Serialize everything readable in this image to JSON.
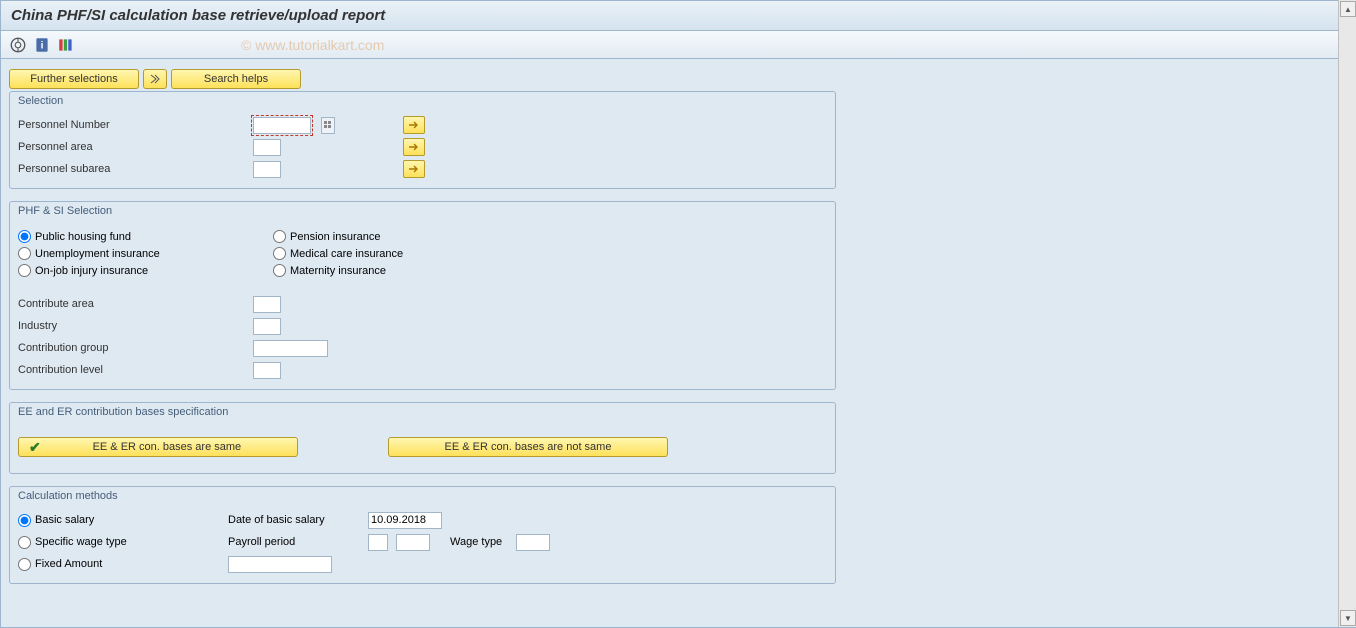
{
  "title": "China PHF/SI calculation base retrieve/upload report",
  "watermark": "© www.tutorialkart.com",
  "topButtons": {
    "further": "Further selections",
    "searchHelps": "Search helps"
  },
  "groups": {
    "selection": {
      "title": "Selection",
      "personnelNumber": "Personnel Number",
      "personnelArea": "Personnel area",
      "personnelSubarea": "Personnel subarea"
    },
    "phfsi": {
      "title": "PHF & SI Selection",
      "options": {
        "phf": "Public housing fund",
        "pension": "Pension insurance",
        "unemployment": "Unemployment insurance",
        "medical": "Medical care insurance",
        "injury": "On-job injury insurance",
        "maternity": "Maternity insurance"
      },
      "contributeArea": "Contribute area",
      "industry": "Industry",
      "contributionGroup": "Contribution group",
      "contributionLevel": "Contribution level"
    },
    "eeer": {
      "title": "EE and ER contribution bases specification",
      "sameBtn": "EE & ER con. bases are same",
      "notSameBtn": "EE & ER con. bases are not same"
    },
    "calc": {
      "title": "Calculation methods",
      "basic": "Basic salary",
      "specific": "Specific wage type",
      "fixed": "Fixed Amount",
      "dateOfBasic": "Date of basic salary",
      "dateValue": "10.09.2018",
      "payrollPeriod": "Payroll period",
      "wageType": "Wage type"
    }
  }
}
